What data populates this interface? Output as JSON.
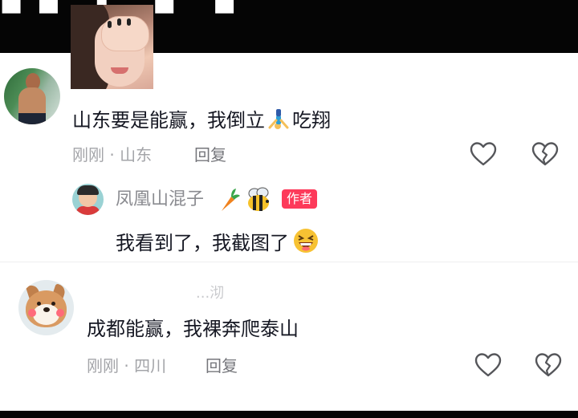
{
  "header": {
    "title_fragment": "■■ ▌ ■ ■"
  },
  "comments": [
    {
      "text_before_emoji": "山东要是能赢，我倒立",
      "emoji_icon": "handstand-person-icon",
      "text_after_emoji": "吃翔",
      "time": "刚刚",
      "location": "山东",
      "meta_separator": "·",
      "reply_label": "回复",
      "has_image": true,
      "replies": [
        {
          "username": "凤凰山混子",
          "username_emojis": [
            "carrot-icon",
            "bee-icon"
          ],
          "badge": "作者",
          "text": "我看到了，我截图了",
          "text_emoji": "grinning-squint-face-icon"
        }
      ]
    },
    {
      "username_partial": "...沏",
      "text": "成都能赢，我裸奔爬泰山",
      "time": "刚刚",
      "location": "四川",
      "meta_separator": "·",
      "reply_label": "回复"
    }
  ],
  "colors": {
    "accent": "#fd3a5a",
    "text": "#161823",
    "meta": "#a3a4a8"
  }
}
